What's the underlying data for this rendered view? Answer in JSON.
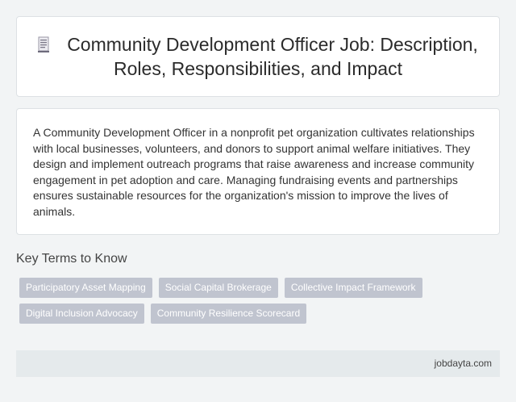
{
  "header": {
    "icon": "document-icon",
    "title": "Community Development Officer Job: Description, Roles, Responsibilities, and Impact"
  },
  "description": {
    "text": "A Community Development Officer in a nonprofit pet organization cultivates relationships with local businesses, volunteers, and donors to support animal welfare initiatives. They design and implement outreach programs that raise awareness and increase community engagement in pet adoption and care. Managing fundraising events and partnerships ensures sustainable resources for the organization's mission to improve the lives of animals."
  },
  "key_terms": {
    "heading": "Key Terms to Know",
    "tags": [
      "Participatory Asset Mapping",
      "Social Capital Brokerage",
      "Collective Impact Framework",
      "Digital Inclusion Advocacy",
      "Community Resilience Scorecard"
    ]
  },
  "footer": {
    "site": "jobdayta.com"
  },
  "colors": {
    "background": "#f2f4f5",
    "card": "#ffffff",
    "tag": "#c0c4cf",
    "footer": "#e5eaec"
  }
}
